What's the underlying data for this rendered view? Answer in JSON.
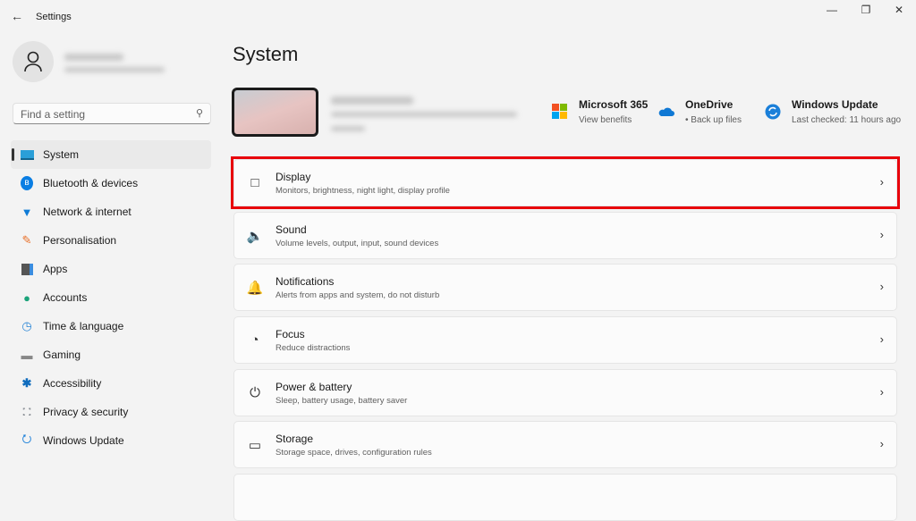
{
  "window": {
    "title": "Settings",
    "back_icon": "arrow-left",
    "controls": [
      "minimize",
      "restore",
      "close"
    ]
  },
  "search": {
    "placeholder": "Find a setting"
  },
  "nav": [
    {
      "label": "System",
      "icon": "monitor-icon",
      "selected": true
    },
    {
      "label": "Bluetooth & devices",
      "icon": "bluetooth-icon"
    },
    {
      "label": "Network & internet",
      "icon": "wifi-icon"
    },
    {
      "label": "Personalisation",
      "icon": "brush-icon"
    },
    {
      "label": "Apps",
      "icon": "apps-icon"
    },
    {
      "label": "Accounts",
      "icon": "person-icon"
    },
    {
      "label": "Time & language",
      "icon": "clock-globe-icon"
    },
    {
      "label": "Gaming",
      "icon": "controller-icon"
    },
    {
      "label": "Accessibility",
      "icon": "accessibility-icon"
    },
    {
      "label": "Privacy & security",
      "icon": "shield-icon"
    },
    {
      "label": "Windows Update",
      "icon": "update-icon"
    }
  ],
  "page": {
    "title": "System"
  },
  "quick_links": [
    {
      "title": "Microsoft 365",
      "subtitle": "View benefits"
    },
    {
      "title": "OneDrive",
      "subtitle": "• Back up files"
    },
    {
      "title": "Windows Update",
      "subtitle": "Last checked: 11 hours ago"
    }
  ],
  "settings": [
    {
      "title": "Display",
      "subtitle": "Monitors, brightness, night light, display profile",
      "icon": "□",
      "highlighted": true
    },
    {
      "title": "Sound",
      "subtitle": "Volume levels, output, input, sound devices",
      "icon": "🔈"
    },
    {
      "title": "Notifications",
      "subtitle": "Alerts from apps and system, do not disturb",
      "icon": "🔔"
    },
    {
      "title": "Focus",
      "subtitle": "Reduce distractions",
      "icon": "◔"
    },
    {
      "title": "Power & battery",
      "subtitle": "Sleep, battery usage, battery saver",
      "icon": "⏻"
    },
    {
      "title": "Storage",
      "subtitle": "Storage space, drives, configuration rules",
      "icon": "▭"
    }
  ],
  "colors": {
    "highlight": "#e8000b",
    "accent": "#0067c0"
  }
}
